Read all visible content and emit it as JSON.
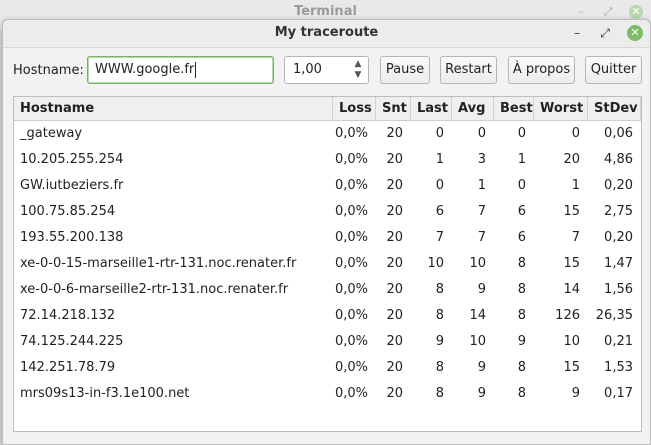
{
  "background_window": {
    "title": "Terminal"
  },
  "window": {
    "title": "My traceroute",
    "controls": {
      "minimize": "minimize-icon",
      "restore": "restore-icon",
      "close": "close-icon"
    }
  },
  "toolbar": {
    "hostname_label": "Hostname:",
    "hostname_value": "WWW.google.fr",
    "interval_value": "1,00",
    "pause_label": "Pause",
    "restart_label": "Restart",
    "about_label": "À propos",
    "quit_label": "Quitter"
  },
  "table": {
    "columns": [
      "Hostname",
      "Loss",
      "Snt",
      "Last",
      "Avg",
      "Best",
      "Worst",
      "StDev"
    ],
    "rows": [
      [
        "_gateway",
        "0,0%",
        "20",
        "0",
        "0",
        "0",
        "0",
        "0,06"
      ],
      [
        "10.205.255.254",
        "0,0%",
        "20",
        "1",
        "3",
        "1",
        "20",
        "4,86"
      ],
      [
        "GW.iutbeziers.fr",
        "0,0%",
        "20",
        "0",
        "1",
        "0",
        "1",
        "0,20"
      ],
      [
        "100.75.85.254",
        "0,0%",
        "20",
        "6",
        "7",
        "6",
        "15",
        "2,75"
      ],
      [
        "193.55.200.138",
        "0,0%",
        "20",
        "7",
        "7",
        "6",
        "7",
        "0,20"
      ],
      [
        "xe-0-0-15-marseille1-rtr-131.noc.renater.fr",
        "0,0%",
        "20",
        "10",
        "10",
        "8",
        "15",
        "1,47"
      ],
      [
        "xe-0-0-6-marseille2-rtr-131.noc.renater.fr",
        "0,0%",
        "20",
        "8",
        "9",
        "8",
        "14",
        "1,56"
      ],
      [
        "72.14.218.132",
        "0,0%",
        "20",
        "8",
        "14",
        "8",
        "126",
        "26,35"
      ],
      [
        "74.125.244.225",
        "0,0%",
        "20",
        "9",
        "10",
        "9",
        "10",
        "0,21"
      ],
      [
        "142.251.78.79",
        "0,0%",
        "20",
        "8",
        "9",
        "8",
        "15",
        "1,53"
      ],
      [
        "mrs09s13-in-f3.1e100.net",
        "0,0%",
        "20",
        "8",
        "9",
        "8",
        "9",
        "0,17"
      ]
    ]
  }
}
